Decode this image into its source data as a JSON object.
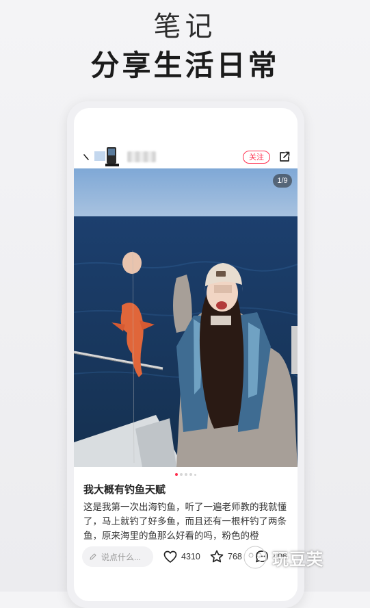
{
  "hero": {
    "subtitle": "笔记",
    "title": "分享生活日常"
  },
  "post": {
    "header": {
      "follow_label": "关注"
    },
    "image_counter": "1/9",
    "pagination": {
      "total_dots": 5,
      "active_index": 0
    },
    "title": "我大概有钓鱼天赋",
    "body": "这是我第一次出海钓鱼，听了一遍老师教的我就懂了，马上就钓了好多鱼，而且还有一根杆钓了两条鱼，原来海里的鱼那么好看的吗，粉色的橙"
  },
  "bottom_bar": {
    "comment_placeholder": "说点什么...",
    "likes": "4310",
    "favorites": "768",
    "comments": "406"
  },
  "watermark": {
    "text": "玩豆芙"
  },
  "icons": {
    "back": "back-icon",
    "share": "share-icon",
    "pencil": "pencil-icon",
    "like": "heart-icon",
    "favorite": "star-icon",
    "comment": "comment-icon"
  },
  "colors": {
    "accent": "#ff2e4d",
    "title": "#1b1b1b",
    "body_text": "#333333"
  }
}
